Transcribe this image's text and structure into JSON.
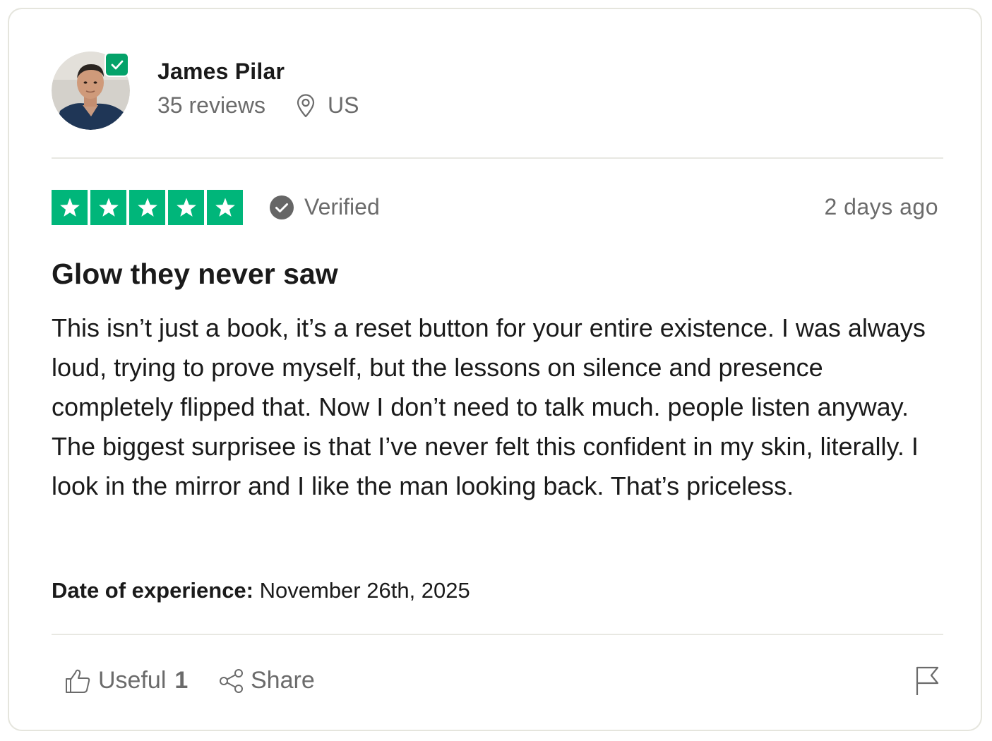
{
  "reviewer": {
    "name": "James Pilar",
    "reviews_count": "35 reviews",
    "location": "US"
  },
  "rating": {
    "stars": 5,
    "max_stars": 5,
    "star_color": "#00b67a",
    "verified_label": "Verified",
    "posted_ago": "2 days ago"
  },
  "review": {
    "title": "Glow they never saw",
    "body": "This isn’t just a book, it’s a reset button for your entire existence. I was always loud, trying to prove myself, but the lessons on silence and presence completely flipped that. Now I don’t need to talk much. people listen anyway. The biggest surprisee is that I’ve never felt this confident in my skin, literally. I look in the mirror and I like the man looking back. That’s priceless."
  },
  "experience": {
    "label": "Date of experience:",
    "date": "November 26th, 2025"
  },
  "actions": {
    "useful_label": "Useful",
    "useful_count": "1",
    "share_label": "Share"
  },
  "icons": {
    "avatar_badge": "check-icon",
    "location": "location-pin-icon",
    "verified": "check-circle-icon",
    "useful": "thumbs-up-icon",
    "share": "share-icon",
    "report": "flag-icon"
  },
  "colors": {
    "brand_green": "#00b67a",
    "badge_green": "#04a269",
    "muted_text": "#6b6b6b",
    "primary_text": "#1a1a1a"
  }
}
